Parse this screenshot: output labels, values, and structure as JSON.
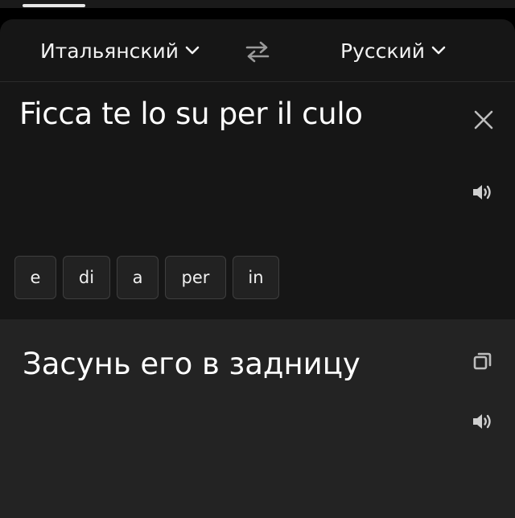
{
  "languages": {
    "source": "Итальянский",
    "target": "Русский"
  },
  "source": {
    "text": "Ficca te lo su per il culo"
  },
  "suggestions": [
    "e",
    "di",
    "a",
    "per",
    "in"
  ],
  "result": {
    "text": "Засунь его в задницу"
  },
  "icons": {
    "chevron": "chevron-down-icon",
    "swap": "swap-languages-icon",
    "clear": "close-icon",
    "speaker": "speaker-icon",
    "copy": "copy-icon"
  },
  "colors": {
    "background": "#000000",
    "panel": "#161616",
    "result_panel": "#232323",
    "text": "#ffffff",
    "icon": "#bdbdbd"
  }
}
